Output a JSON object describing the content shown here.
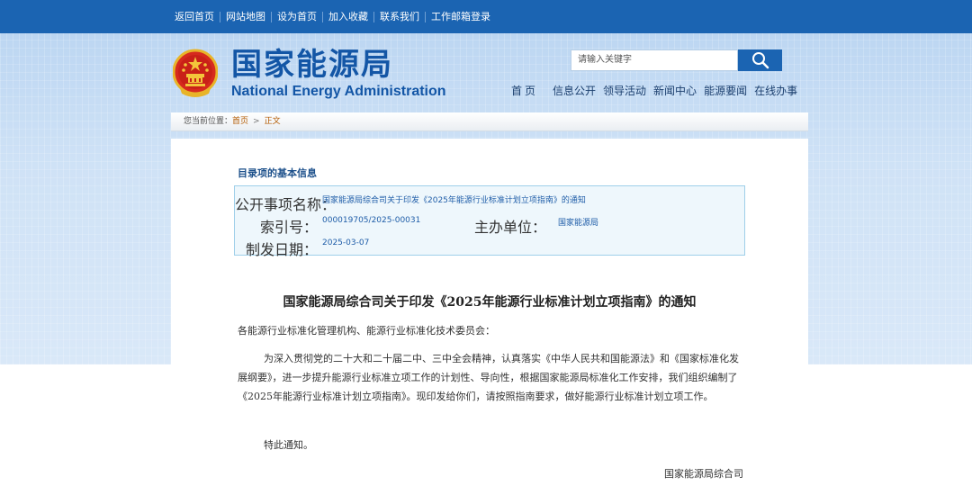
{
  "top_nav": {
    "links": [
      "返回首页",
      "网站地图",
      "设为首页",
      "加入收藏",
      "联系我们",
      "工作邮箱登录"
    ]
  },
  "logo": {
    "cn": "国家能源局",
    "en": "National Energy Administration"
  },
  "search": {
    "placeholder": "请输入关键字"
  },
  "main_nav": {
    "items": [
      "首页",
      "信息公开",
      "领导活动",
      "新闻中心",
      "能源要闻",
      "在线办事"
    ]
  },
  "breadcrumb": {
    "prefix": "您当前位置：",
    "items": [
      "首页",
      "正文"
    ],
    "separator": ">"
  },
  "info": {
    "section_title": "目录项的基本信息",
    "title_label": "公开事项名称：",
    "title_value": "国家能源局综合司关于印发《2025年能源行业标准计划立项指南》的通知",
    "index_label": "索引号：",
    "index_value": "000019705/2025-00031",
    "unit_label": "主办单位：",
    "unit_value": "国家能源局",
    "date_label": "制发日期：",
    "date_value": "2025-03-07"
  },
  "document": {
    "title": "国家能源局综合司关于印发《2025年能源行业标准计划立项指南》的通知",
    "salutation": "各能源行业标准化管理机构、能源行业标准化技术委员会：",
    "body": "为深入贯彻党的二十大和二十届二中、三中全会精神，认真落实《中华人民共和国能源法》和《国家标准化发展纲要》，进一步提升能源行业标准立项工作的计划性、导向性，根据国家能源局标准化工作安排，我们组织编制了《2025年能源行业标准计划立项指南》。现印发给你们，请按照指南要求，做好能源行业标准计划立项工作。",
    "closing": "特此通知。",
    "signature": "国家能源局综合司"
  },
  "colors": {
    "top_bar": "#1b64b2",
    "logo_blue": "#1356a6",
    "link_blue": "#1f5da8",
    "info_bg": "#eef7fc",
    "info_border": "#9fcfe9"
  },
  "icons": {
    "emblem": "national-emblem-icon",
    "search": "search-icon"
  }
}
